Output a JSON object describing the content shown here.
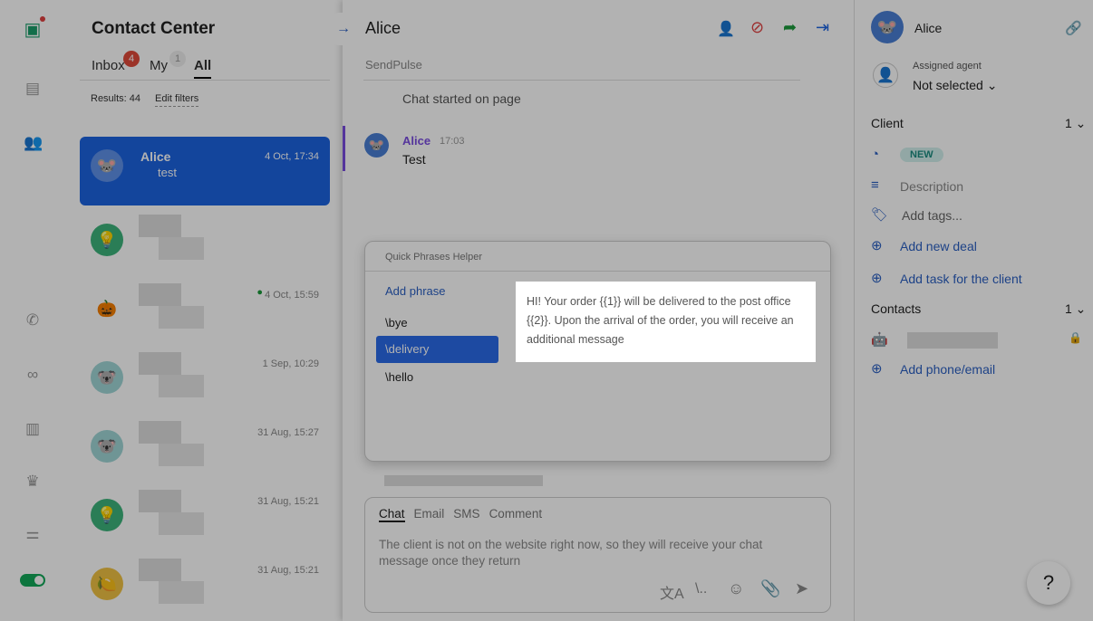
{
  "rail": {
    "icons": [
      "logo-icon",
      "contacts-book-icon",
      "users-icon",
      "phone-icon",
      "binoculars-icon",
      "chart-icon",
      "crown-icon",
      "settings-sliders-icon",
      "toggle"
    ]
  },
  "list": {
    "title": "Contact Center",
    "tabs": [
      {
        "label": "Inbox",
        "badge": "4"
      },
      {
        "label": "My",
        "badge": "1"
      },
      {
        "label": "All"
      }
    ],
    "results": "Results: 44",
    "edit_filters": "Edit filters",
    "rows": [
      {
        "name": "Alice",
        "preview": "test",
        "time": "4 Oct, 17:34",
        "avatar": "🐭",
        "color": "#4a7fd4"
      },
      {
        "time": "",
        "avatar": "💡",
        "color": "#3db37b"
      },
      {
        "time": "4 Oct, 15:59",
        "avatar": "🎃",
        "color": "transparent"
      },
      {
        "time": "1 Sep, 10:29",
        "avatar": "🐨",
        "color": "#9fd6d6"
      },
      {
        "time": "31 Aug, 15:27",
        "avatar": "🐨",
        "color": "#9fd6d6"
      },
      {
        "time": "31 Aug, 15:21",
        "avatar": "💡",
        "color": "#3db37b"
      },
      {
        "time": "31 Aug, 15:21",
        "avatar": "🍋",
        "color": "#f0c244"
      }
    ]
  },
  "chat": {
    "title": "Alice",
    "source": "SendPulse",
    "system": "Chat started on page",
    "message": {
      "author": "Alice",
      "time": "17:03",
      "text": "Test"
    },
    "quick": {
      "title": "Quick Phrases Helper",
      "add": "Add phrase",
      "phrases": [
        "\\bye",
        "\\delivery",
        "\\hello"
      ],
      "preview": "HI! Your order {{1}} will be delivered to the post office {{2}}. Upon the arrival of the order, you will receive an additional message"
    },
    "composer": {
      "tabs": [
        "Chat",
        "Email",
        "SMS",
        "Comment"
      ],
      "placeholder": "The client is not on the website right now, so they will receive your chat message once they return",
      "quick_icon": "\\.."
    }
  },
  "right": {
    "name": "Alice",
    "agent_label": "Assigned agent",
    "agent_value": "Not selected",
    "client": "Client",
    "client_count": "1",
    "status": "NEW",
    "description": "Description",
    "tags": "Add tags...",
    "add_deal": "Add new deal",
    "add_task": "Add task for the client",
    "contacts": "Contacts",
    "contacts_count": "1",
    "add_phone": "Add phone/email"
  },
  "help": "?"
}
